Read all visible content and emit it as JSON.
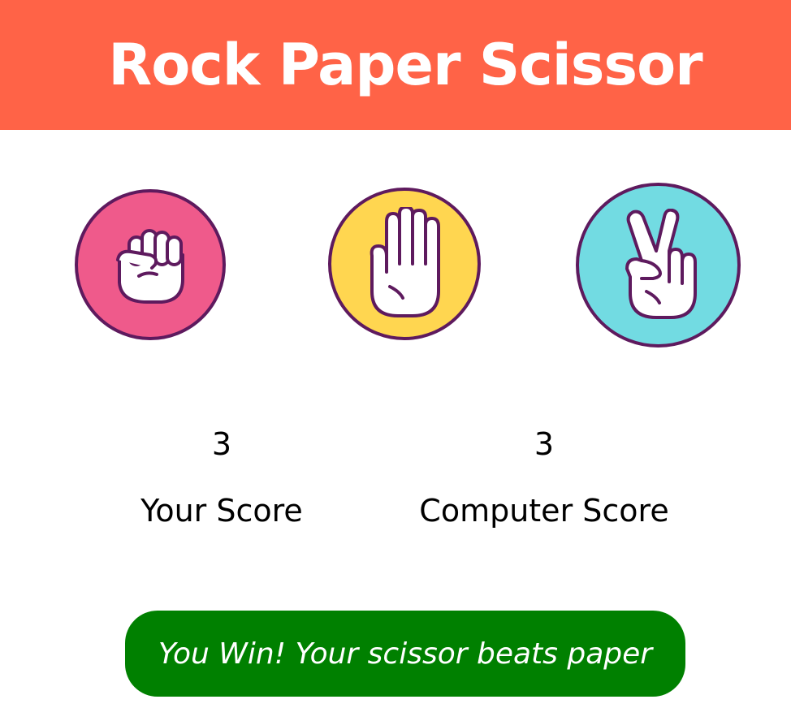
{
  "title": "Rock Paper Scissor",
  "choices": [
    {
      "name": "rock",
      "icon": "rock-fist-icon",
      "color": "#ef5a8b"
    },
    {
      "name": "paper",
      "icon": "paper-hand-icon",
      "color": "#ffd650"
    },
    {
      "name": "scissor",
      "icon": "scissor-hand-icon",
      "color": "#72dbe2"
    }
  ],
  "scores": {
    "user": {
      "value": "3",
      "label": "Your Score"
    },
    "computer": {
      "value": "3",
      "label": "Computer Score"
    }
  },
  "message": {
    "text": "You Win! Your scissor beats paper",
    "color": "#008000"
  },
  "colors": {
    "header": "#ff6347",
    "outline": "#5e1a5e"
  }
}
